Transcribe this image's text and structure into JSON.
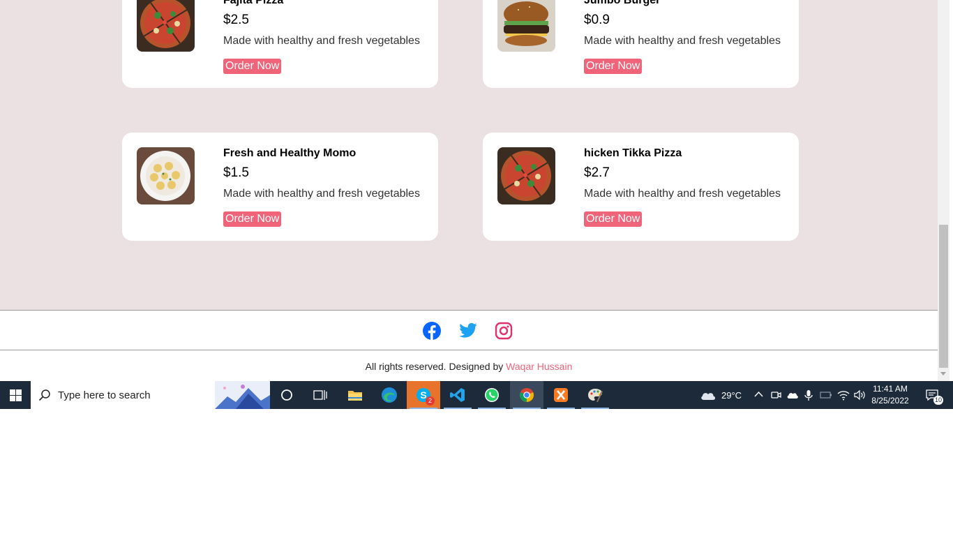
{
  "menu": {
    "items": [
      {
        "name": "Fajita Pizza",
        "price": "$2.5",
        "description": "Made with healthy and fresh vegetables",
        "button": "Order Now",
        "image": "pizza"
      },
      {
        "name": "Jumbo Burger",
        "price": "$0.9",
        "description": "Made with healthy and fresh vegetables",
        "button": "Order Now",
        "image": "burger"
      },
      {
        "name": "Fresh and Healthy Momo",
        "price": "$1.5",
        "description": "Made with healthy and fresh vegetables",
        "button": "Order Now",
        "image": "momo"
      },
      {
        "name": "hicken Tikka Pizza",
        "price": "$2.7",
        "description": "Made with healthy and fresh vegetables",
        "button": "Order Now",
        "image": "pizza"
      }
    ]
  },
  "footer": {
    "social": [
      {
        "icon": "facebook-icon",
        "color": "#1877f2"
      },
      {
        "icon": "twitter-icon",
        "color": "#1da1f2"
      },
      {
        "icon": "instagram-icon",
        "color": "#e1306c"
      }
    ],
    "copyright_prefix": "All rights reserved. Designed by",
    "author": "Waqar Hussain"
  },
  "taskbar": {
    "search_placeholder": "Type here to search",
    "skype_badge": "2",
    "weather": "29°C",
    "time": "11:41 AM",
    "date": "8/25/2022",
    "notification_count": "10"
  },
  "colors": {
    "accent": "#f0647a",
    "page_bg": "#ebe1e2",
    "taskbar_bg": "#1c2a3a"
  }
}
